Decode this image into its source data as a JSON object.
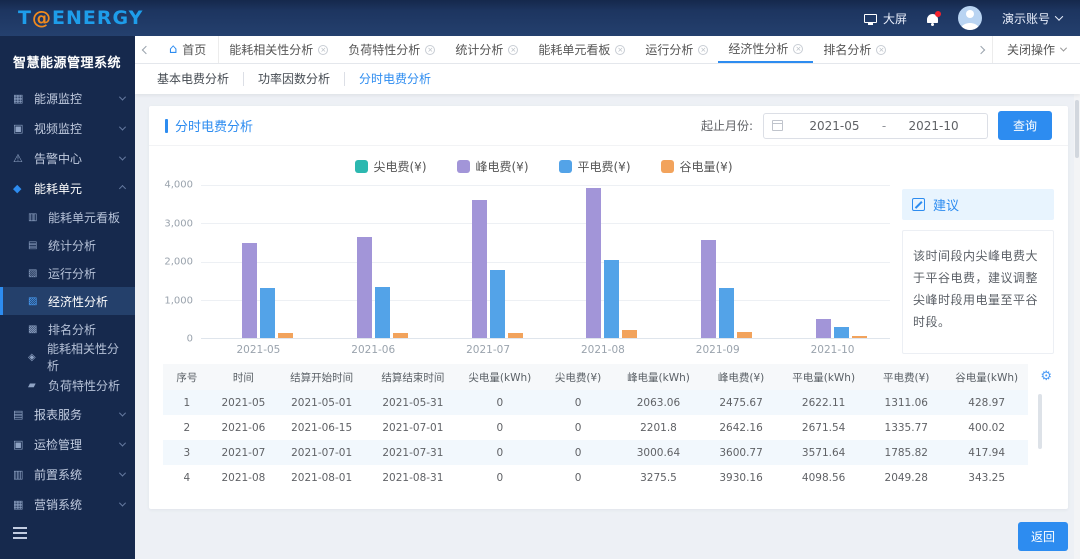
{
  "topbar": {
    "logo_t": "T",
    "logo_at": "@",
    "logo_rest": "ENERGY",
    "big_screen_label": "大屏",
    "account_label": "演示账号"
  },
  "sidebar": {
    "title": "智慧能源管理系统",
    "items": [
      {
        "key": "energy-monitoring",
        "label": "能源监控",
        "icon": "energy-monitor-icon",
        "expanded": false
      },
      {
        "key": "video-monitoring",
        "label": "视频监控",
        "icon": "video-monitor-icon",
        "expanded": false
      },
      {
        "key": "alarm-center",
        "label": "告警中心",
        "icon": "alarm-center-icon",
        "expanded": false
      },
      {
        "key": "energy-unit",
        "label": "能耗单元",
        "icon": "energy-unit-icon",
        "expanded": true,
        "active": true,
        "children": [
          {
            "key": "energy-unit-board",
            "label": "能耗单元看板",
            "icon": "unit-board-icon"
          },
          {
            "key": "statistical-analysis",
            "label": "统计分析",
            "icon": "stats-analysis-icon"
          },
          {
            "key": "operation-analysis",
            "label": "运行分析",
            "icon": "operation-analysis-icon"
          },
          {
            "key": "economic-analysis",
            "label": "经济性分析",
            "icon": "economic-analysis-icon",
            "active": true
          },
          {
            "key": "ranking-analysis",
            "label": "排名分析",
            "icon": "ranking-analysis-icon"
          },
          {
            "key": "correlation-analysis",
            "label": "能耗相关性分析",
            "icon": "correlation-analysis-icon"
          },
          {
            "key": "load-characteristic",
            "label": "负荷特性分析",
            "icon": "load-characteristic-icon"
          }
        ]
      },
      {
        "key": "report-service",
        "label": "报表服务",
        "icon": "report-service-icon",
        "expanded": false
      },
      {
        "key": "maintenance-management",
        "label": "运检管理",
        "icon": "maintenance-icon",
        "expanded": false
      },
      {
        "key": "front-system",
        "label": "前置系统",
        "icon": "front-system-icon",
        "expanded": false
      },
      {
        "key": "marketing-system",
        "label": "营销系统",
        "icon": "marketing-system-icon",
        "expanded": false
      }
    ]
  },
  "tabs": {
    "home_label": "首页",
    "close_ops_label": "关闭操作",
    "items": [
      {
        "key": "correlation-analysis",
        "label": "能耗相关性分析",
        "active": false
      },
      {
        "key": "load-characteristic-analysis",
        "label": "负荷特性分析",
        "active": false
      },
      {
        "key": "statistical-analysis",
        "label": "统计分析",
        "active": false
      },
      {
        "key": "energy-unit-board",
        "label": "能耗单元看板",
        "active": false
      },
      {
        "key": "operation-analysis",
        "label": "运行分析",
        "active": false
      },
      {
        "key": "economic-analysis",
        "label": "经济性分析",
        "active": true
      },
      {
        "key": "ranking-analysis",
        "label": "排名分析",
        "active": false
      }
    ]
  },
  "subtabs": [
    {
      "key": "basic-electricity-fee",
      "label": "基本电费分析",
      "active": false
    },
    {
      "key": "power-factor",
      "label": "功率因数分析",
      "active": false
    },
    {
      "key": "time-of-use-fee",
      "label": "分时电费分析",
      "active": true
    }
  ],
  "panel": {
    "title": "分时电费分析"
  },
  "filter": {
    "label": "起止月份:",
    "start": "2021-05",
    "separator": "-",
    "end": "2021-10",
    "query_label": "查询"
  },
  "chart_data": {
    "type": "bar",
    "title": "分时电费分析",
    "categories": [
      "2021-05",
      "2021-06",
      "2021-07",
      "2021-08",
      "2021-09",
      "2021-10"
    ],
    "series": [
      {
        "key": "sharp",
        "name": "尖电费(¥)",
        "color": "#2cb8b0",
        "values": [
          0,
          0,
          0,
          0,
          0,
          0
        ]
      },
      {
        "key": "peak",
        "name": "峰电费(¥)",
        "color": "#a295d8",
        "values": [
          2475.67,
          2642.16,
          3600.77,
          3930.16,
          2560,
          500
        ]
      },
      {
        "key": "flat",
        "name": "平电费(¥)",
        "color": "#53a3e8",
        "values": [
          1311.06,
          1335.77,
          1785.82,
          2049.28,
          1320,
          300
        ]
      },
      {
        "key": "valley",
        "name": "谷电量(¥)",
        "color": "#f2a35c",
        "values": [
          130,
          120,
          125,
          200,
          170,
          45
        ]
      }
    ],
    "xlabel": "",
    "ylabel": "",
    "ylim": [
      0,
      4000
    ],
    "ytick_labels": [
      "0",
      "1,000",
      "2,000",
      "3,000",
      "4,000"
    ],
    "grid": true,
    "legend_position": "top"
  },
  "suggestion": {
    "title": "建议",
    "text": "该时间段内尖峰电费大于平谷电费，建议调整尖峰时段用电量至平谷时段。"
  },
  "table": {
    "columns": [
      "序号",
      "时间",
      "结算开始时间",
      "结算结束时间",
      "尖电量(kWh)",
      "尖电费(¥)",
      "峰电量(kWh)",
      "峰电费(¥)",
      "平电量(kWh)",
      "平电费(¥)",
      "谷电量(kWh)"
    ],
    "rows": [
      [
        "1",
        "2021-05",
        "2021-05-01",
        "2021-05-31",
        "0",
        "0",
        "2063.06",
        "2475.67",
        "2622.11",
        "1311.06",
        "428.97"
      ],
      [
        "2",
        "2021-06",
        "2021-06-15",
        "2021-07-01",
        "0",
        "0",
        "2201.8",
        "2642.16",
        "2671.54",
        "1335.77",
        "400.02"
      ],
      [
        "3",
        "2021-07",
        "2021-07-01",
        "2021-07-31",
        "0",
        "0",
        "3000.64",
        "3600.77",
        "3571.64",
        "1785.82",
        "417.94"
      ],
      [
        "4",
        "2021-08",
        "2021-08-01",
        "2021-08-31",
        "0",
        "0",
        "3275.5",
        "3930.16",
        "4098.56",
        "2049.28",
        "343.25"
      ]
    ]
  },
  "footer": {
    "return_label": "返回"
  }
}
